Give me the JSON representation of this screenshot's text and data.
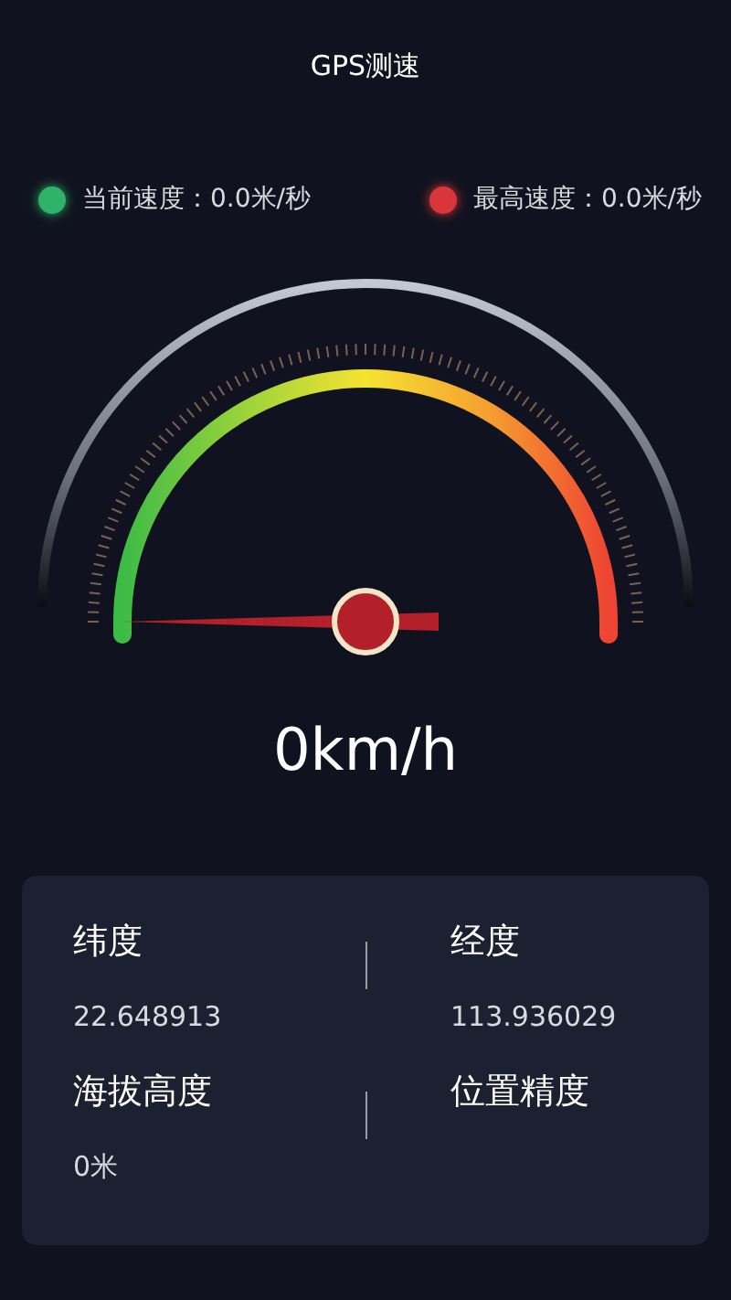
{
  "title": "GPS测速",
  "legend": [
    {
      "label": "当前速度：0.0米/秒",
      "color": "#2fb36a"
    },
    {
      "label": "最高速度：0.0米/秒",
      "color": "#d9363b"
    }
  ],
  "speed": "0km/h",
  "info": [
    {
      "label": "纬度",
      "value": "22.648913"
    },
    {
      "label": "经度",
      "value": "113.936029"
    },
    {
      "label": "海拔高度",
      "value": "0米"
    },
    {
      "label": "位置精度"
    }
  ]
}
